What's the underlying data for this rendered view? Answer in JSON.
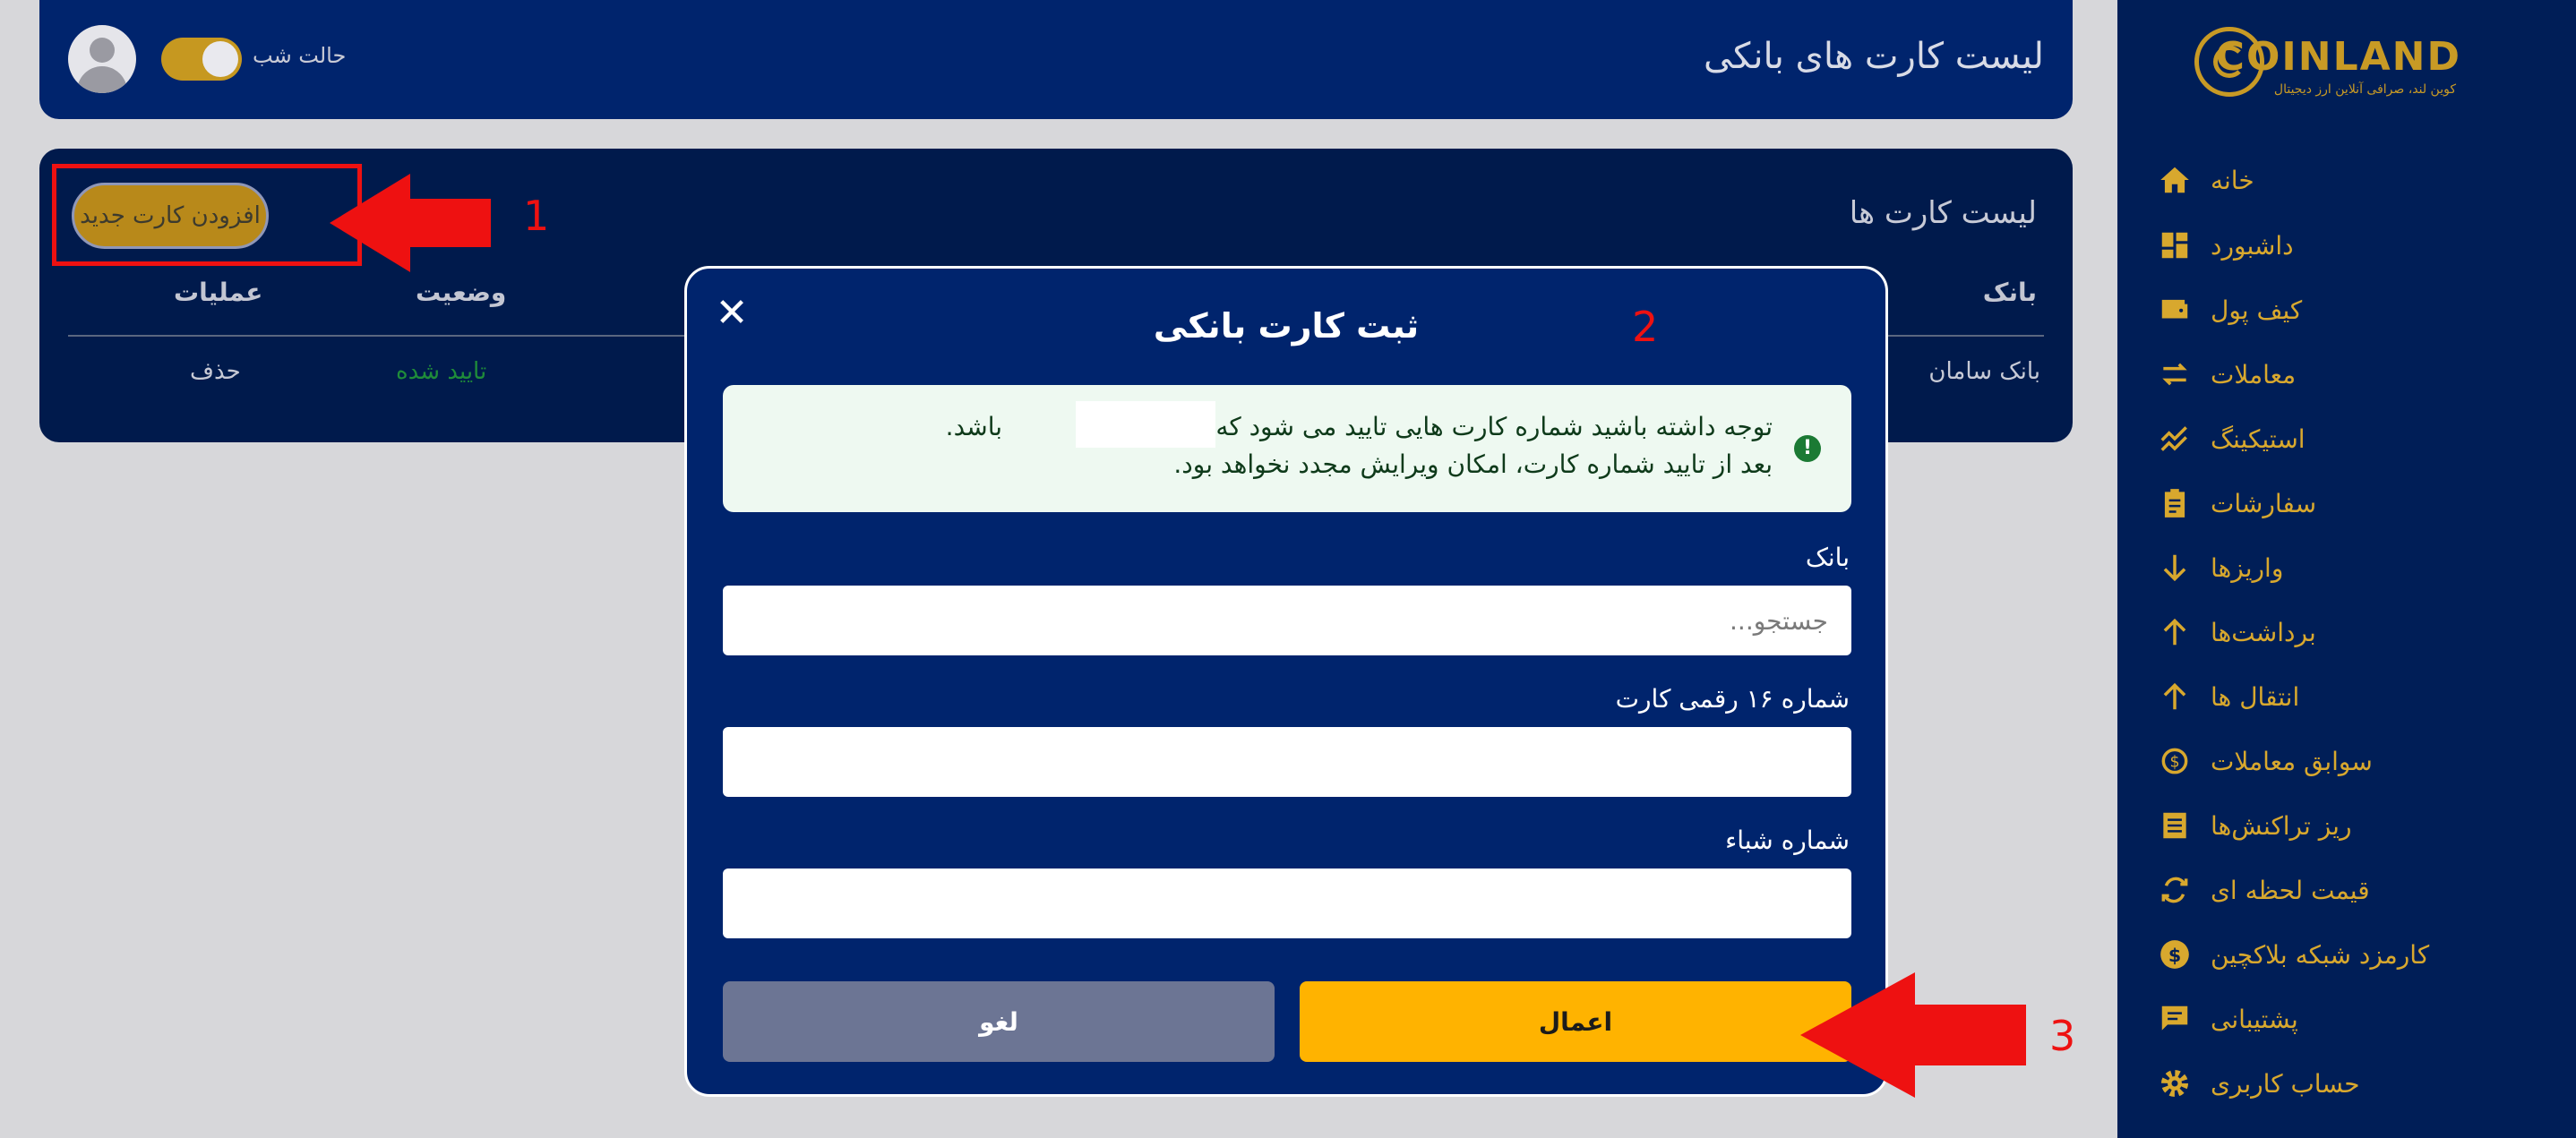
{
  "app": {
    "logo_text": "COINLAND",
    "logo_subtitle": "کوین لند، صرافی آنلاین ارز دیجیتال"
  },
  "sidebar": {
    "items": [
      {
        "label": "خانه",
        "icon": "home-icon"
      },
      {
        "label": "داشبورد",
        "icon": "dashboard-icon"
      },
      {
        "label": "کیف پول",
        "icon": "wallet-icon"
      },
      {
        "label": "معاملات",
        "icon": "swap-icon"
      },
      {
        "label": "استیکینگ",
        "icon": "staking-chart-icon"
      },
      {
        "label": "سفارشات",
        "icon": "clipboard-icon"
      },
      {
        "label": "واریزها",
        "icon": "arrow-down-icon"
      },
      {
        "label": "برداشت‌ها",
        "icon": "arrow-up-icon"
      },
      {
        "label": "انتقال ها",
        "icon": "arrow-up-icon"
      },
      {
        "label": "سوابق معاملات",
        "icon": "history-dollar-icon"
      },
      {
        "label": "ریز تراکنش‌ها",
        "icon": "receipt-icon"
      },
      {
        "label": "قیمت لحظه ای",
        "icon": "refresh-icon"
      },
      {
        "label": "کارمزد شبکه بلاکچین",
        "icon": "dollar-coin-icon"
      },
      {
        "label": "پشتیبانی",
        "icon": "chat-icon"
      },
      {
        "label": "حساب کاربری",
        "icon": "gear-icon"
      }
    ]
  },
  "header": {
    "title": "لیست کارت های بانکی",
    "night_mode_label": "حالت شب"
  },
  "panel": {
    "title": "لیست کارت ها",
    "add_button": "افزودن کارت جدید",
    "columns": {
      "bank": "بانک",
      "status": "وضعیت",
      "actions": "عملیات"
    },
    "rows": [
      {
        "bank": "بانک سامان",
        "status": "تایید شده",
        "action": "حذف"
      }
    ]
  },
  "modal": {
    "title": "ثبت کارت بانکی",
    "alert_line1_part1": "توجه داشته باشید شماره کارت هایی تایید می شود که به نام",
    "alert_line1_part2": "باشد.",
    "alert_line2": "بعد از تایید شماره کارت، امکان ویرایش مجدد نخواهد بود.",
    "bank_label": "بانک",
    "bank_placeholder": "جستجو...",
    "card_label": "شماره ۱۶ رقمی کارت",
    "sheba_label": "شماره شباء",
    "apply_button": "اعمال",
    "cancel_button": "لغو"
  },
  "annotations": {
    "step1": "1",
    "step2": "2",
    "step3": "3"
  },
  "colors": {
    "sidebar_bg": "#001e57",
    "header_bg": "#00246d",
    "accent": "#ffb300",
    "annotation_red": "#ee1111"
  }
}
